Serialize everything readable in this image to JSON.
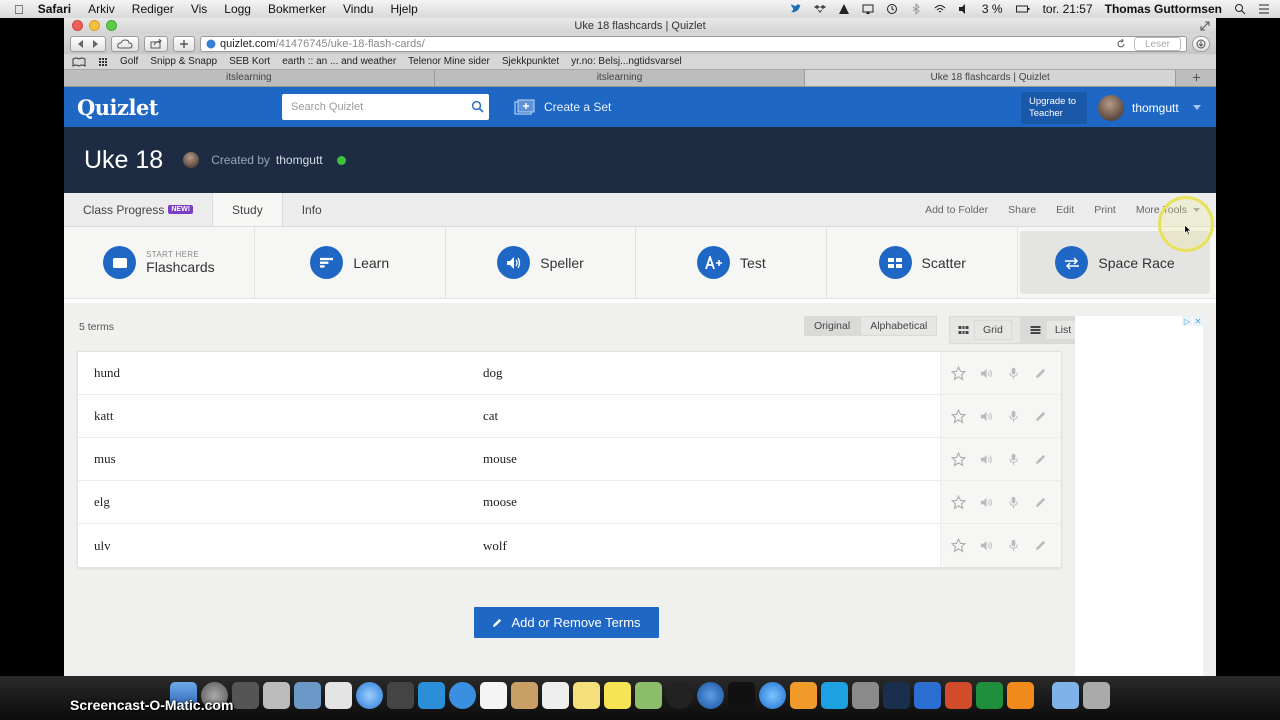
{
  "menubar": {
    "app": "Safari",
    "items": [
      "Arkiv",
      "Rediger",
      "Vis",
      "Logg",
      "Bokmerker",
      "Vindu",
      "Hjelp"
    ],
    "battery": "3 %",
    "clock": "tor. 21:57",
    "user": "Thomas Guttormsen"
  },
  "browser": {
    "window_title": "Uke 18 flashcards | Quizlet",
    "url_domain": "quizlet.com",
    "url_path": "/41476745/uke-18-flash-cards/",
    "reader_label": "Leser",
    "bookmarks": [
      "Golf",
      "Snipp & Snapp",
      "SEB Kort",
      "earth :: an ... and weather",
      "Telenor Mine sider",
      "Sjekkpunktet",
      "yr.no: Belsj...ngtidsvarsel"
    ],
    "tabs": [
      {
        "label": "itslearning",
        "active": false
      },
      {
        "label": "itslearning",
        "active": false
      },
      {
        "label": "Uke 18 flashcards | Quizlet",
        "active": true
      }
    ]
  },
  "header": {
    "logo": "Quizlet",
    "search_placeholder": "Search Quizlet",
    "create_label": "Create a Set",
    "upgrade_line1": "Upgrade to",
    "upgrade_line2": "Teacher",
    "username": "thomgutt"
  },
  "set": {
    "title": "Uke 18",
    "created_by_prefix": "Created by",
    "creator": "thomgutt"
  },
  "subnav": {
    "tabs": [
      "Class Progress",
      "Study",
      "Info"
    ],
    "new_badge": "NEW!",
    "actions": [
      "Add to Folder",
      "Share",
      "Edit",
      "Print",
      "More Tools"
    ]
  },
  "modes": {
    "start_here": "START HERE",
    "items": [
      "Flashcards",
      "Learn",
      "Speller",
      "Test",
      "Scatter",
      "Space Race"
    ]
  },
  "terms": {
    "count_label": "5 terms",
    "order_options": [
      "Original",
      "Alphabetical"
    ],
    "view_options": [
      "Grid",
      "List"
    ],
    "rows": [
      {
        "term": "hund",
        "definition": "dog"
      },
      {
        "term": "katt",
        "definition": "cat"
      },
      {
        "term": "mus",
        "definition": "mouse"
      },
      {
        "term": "elg",
        "definition": "moose"
      },
      {
        "term": "ulv",
        "definition": "wolf"
      }
    ],
    "add_button": "Add or Remove Terms"
  },
  "watermark": "Screencast-O-Matic.com",
  "colors": {
    "quizlet_blue": "#1f67c4",
    "set_header": "#1d2c43",
    "online_green": "#3cc13c"
  }
}
